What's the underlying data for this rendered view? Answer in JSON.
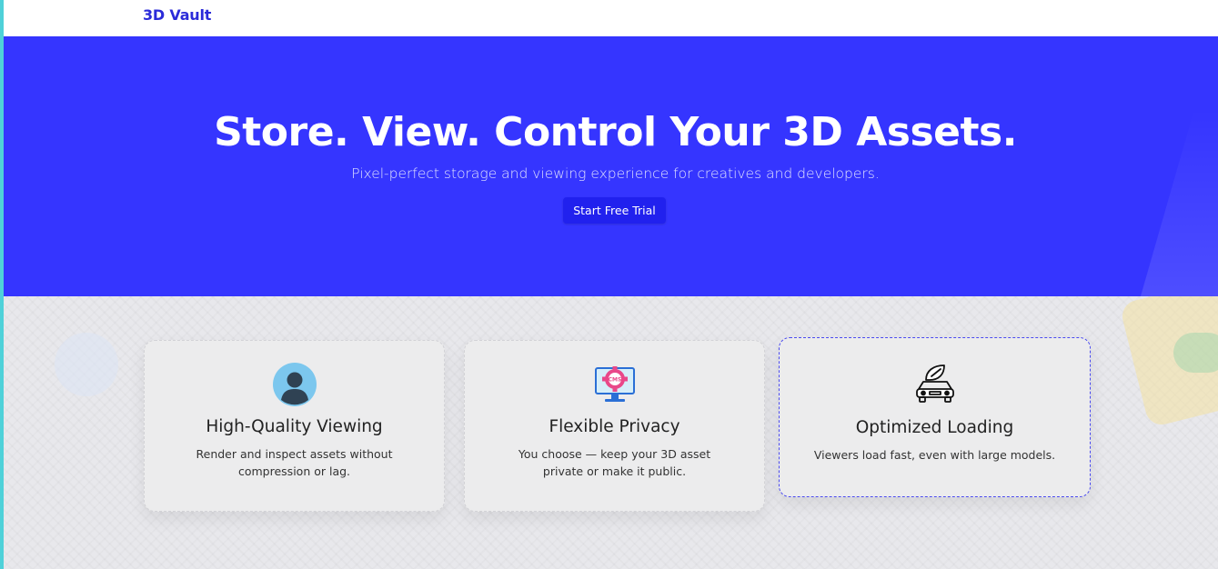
{
  "navbar": {
    "brand": "3D Vault"
  },
  "hero": {
    "title": "Store. View. Control Your 3D Assets.",
    "subtitle": "Pixel-perfect storage and viewing experience for creatives and developers.",
    "cta_label": "Start Free Trial",
    "background_color": "#3535ff"
  },
  "features": [
    {
      "icon": "user-avatar-icon",
      "title": "High-Quality Viewing",
      "description": "Render and inspect assets without compression or lag."
    },
    {
      "icon": "cms-settings-monitor-icon",
      "title": "Flexible Privacy",
      "description": "You choose — keep your 3D asset private or make it public."
    },
    {
      "icon": "car-leaf-icon",
      "title": "Optimized Loading",
      "description": "Viewers load fast, even with large models."
    }
  ],
  "colors": {
    "brand": "#2b2bd9",
    "accent": "#3535ff",
    "cta": "#2121ee",
    "highlight_border": "#4a4af0"
  }
}
